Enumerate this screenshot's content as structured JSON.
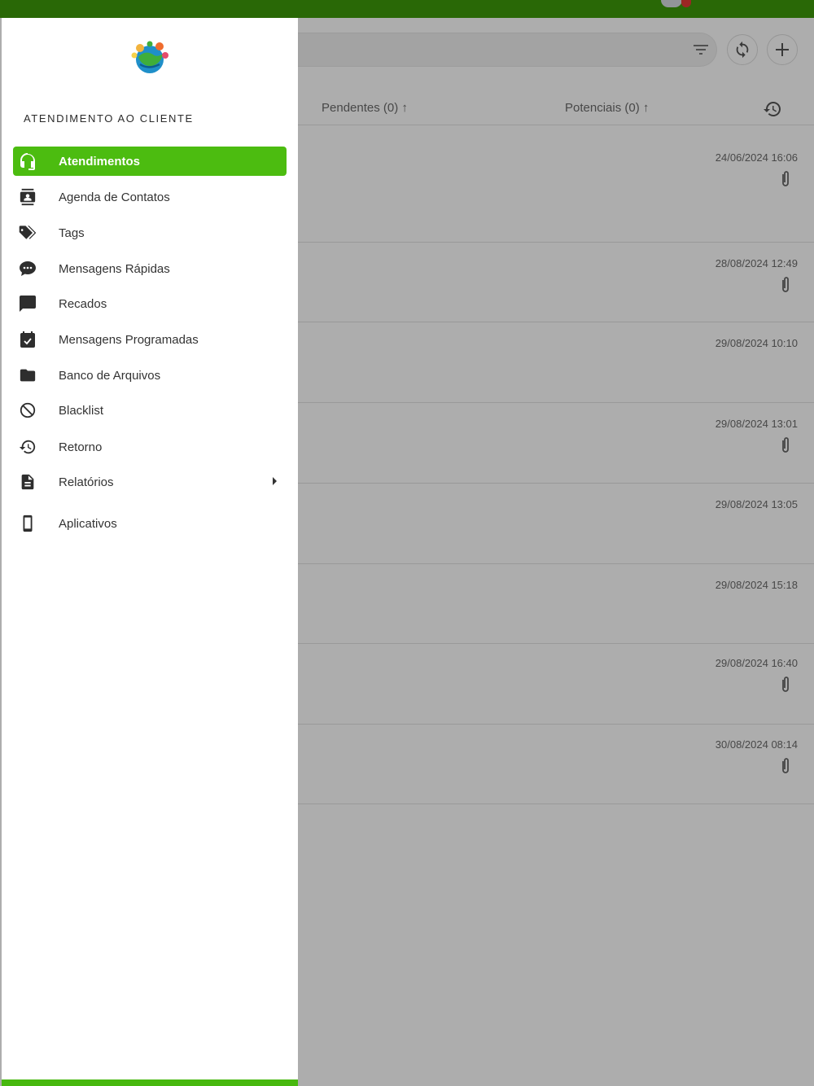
{
  "colors": {
    "topbar": "#3d9a0a",
    "active_item": "#4cbc10",
    "drawer_bottom": "#47b80f",
    "overlay": "rgba(0,0,0,0.32)"
  },
  "header": {
    "icons": [
      "filter-icon",
      "refresh-icon",
      "add-icon"
    ]
  },
  "tabs": {
    "pendentes": "Pendentes (0) ↑",
    "potenciais": "Potenciais (0) ↑"
  },
  "tickets": [
    {
      "time": "24/06/2024 16:06",
      "attachment": true
    },
    {
      "time": "28/08/2024 12:49",
      "attachment": true
    },
    {
      "time": "29/08/2024 10:10",
      "attachment": false
    },
    {
      "time": "29/08/2024 13:01",
      "attachment": true
    },
    {
      "time": "29/08/2024 13:05",
      "attachment": false
    },
    {
      "time": "29/08/2024 15:18",
      "attachment": false
    },
    {
      "time": "29/08/2024 16:40",
      "attachment": true
    },
    {
      "time": "30/08/2024 08:14",
      "attachment": true
    }
  ],
  "drawer": {
    "section_title": "ATENDIMENTO AO CLIENTE",
    "items": [
      {
        "label": "Atendimentos",
        "icon": "headset-icon",
        "active": true
      },
      {
        "label": "Agenda de Contatos",
        "icon": "contacts-icon",
        "active": false
      },
      {
        "label": "Tags",
        "icon": "tags-icon",
        "active": false
      },
      {
        "label": "Mensagens Rápidas",
        "icon": "chat-bubbles-icon",
        "active": false
      },
      {
        "label": "Recados",
        "icon": "message-icon",
        "active": false
      },
      {
        "label": "Mensagens Programadas",
        "icon": "calendar-check-icon",
        "active": false
      },
      {
        "label": "Banco de Arquivos",
        "icon": "folder-icon",
        "active": false
      },
      {
        "label": "Blacklist",
        "icon": "block-icon",
        "active": false
      },
      {
        "label": "Retorno",
        "icon": "history-icon",
        "active": false
      },
      {
        "label": "Relatórios",
        "icon": "document-icon",
        "active": false,
        "has_submenu": true
      },
      {
        "label": "Aplicativos",
        "icon": "smartphone-icon",
        "active": false
      }
    ]
  }
}
